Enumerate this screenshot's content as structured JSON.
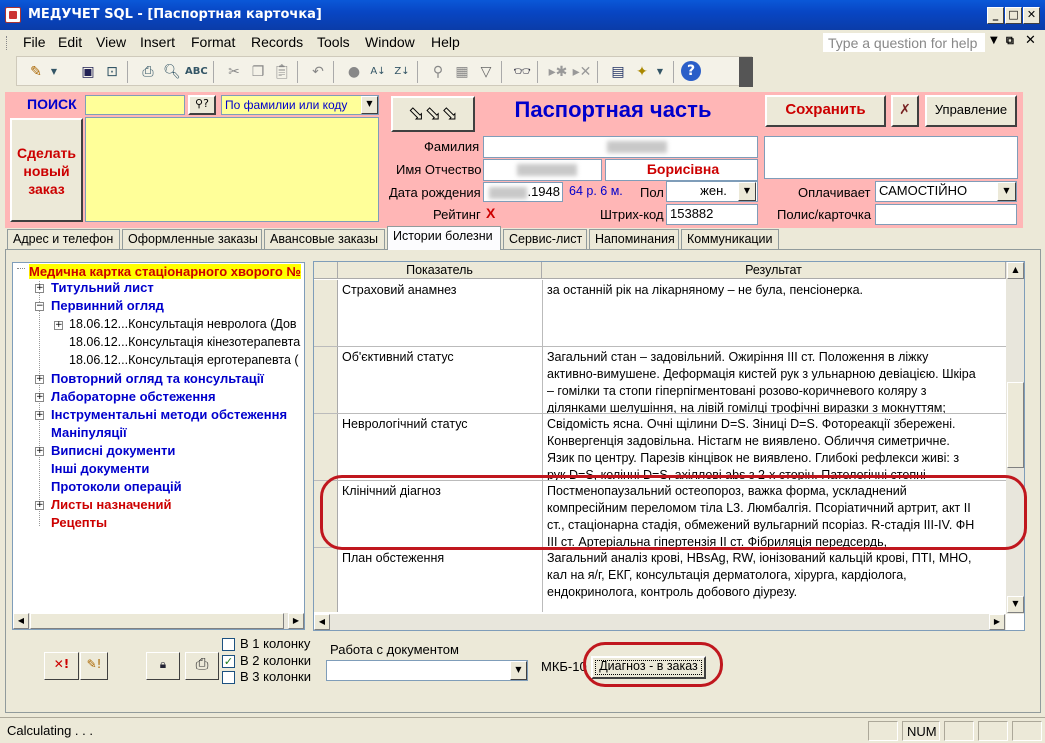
{
  "window": {
    "title": "МЕДУЧЕТ SQL - [Паспортная карточка]"
  },
  "menu": {
    "items": [
      "File",
      "Edit",
      "View",
      "Insert",
      "Format",
      "Records",
      "Tools",
      "Window",
      "Help"
    ],
    "help_placeholder": "Type a question for help"
  },
  "header": {
    "search_label": "ПОИСК",
    "search_value": "",
    "search_mode": "По фамилии или коду",
    "new_order_button": "Сделать новый заказ",
    "section_title": "Паспортная часть",
    "save_button": "Сохранить",
    "manage_button": "Управление",
    "surname_label": "Фамилия",
    "name_label": "Имя Отчество",
    "patronymic": "Борисівна",
    "dob_label": "Дата рождения",
    "dob_year": ".1948",
    "age": "64 р. 6 м.",
    "sex_label": "Пол",
    "sex_value": "жен.",
    "payer_label": "Оплачивает",
    "payer_value": "САМОСТІЙНО",
    "rating_label": "Рейтинг",
    "rating_value": "X",
    "barcode_label": "Штрих-код",
    "barcode_value": "153882",
    "policy_label": "Полис/карточка"
  },
  "tabs": [
    "Адрес и телефон",
    "Оформленные заказы",
    "Авансовые заказы",
    "Истории болезни",
    "Сервис-лист",
    "Напоминания",
    "Коммуникации"
  ],
  "active_tab": "Истории болезни",
  "tree": {
    "root": "Медична картка стаціонарного хворого №",
    "nodes": [
      {
        "label": "Титульний лист"
      },
      {
        "label": "Первинний огляд"
      },
      {
        "label": "18.06.12...Консультація невролога (Дов"
      },
      {
        "label": "18.06.12...Консультація кінезотерапевта"
      },
      {
        "label": "18.06.12...Консультація ерготерапевта ("
      },
      {
        "label": "Повторний огляд та консультації"
      },
      {
        "label": "Лабораторне обстеження"
      },
      {
        "label": "Інструментальні методи обстеження"
      },
      {
        "label": "Маніпуляції"
      },
      {
        "label": "Виписні документи"
      },
      {
        "label": "Інші документи"
      },
      {
        "label": "Протоколи операцій"
      },
      {
        "label": "Листы назначений"
      },
      {
        "label": "Рецепты"
      }
    ]
  },
  "grid": {
    "columns": [
      "Показатель",
      "Результат"
    ],
    "rows": [
      {
        "indicator": "Страховий анамнез",
        "result": "за останній рік на лікарняному – не була, пенсіонерка."
      },
      {
        "indicator": "Об'єктивний статус",
        "result": "Загальний стан – задовільний. Ожиріння ІІІ ст. Положення в ліжку активно-вимушене. Деформація кистей рук з ульнарною девіацією. Шкіра – гомілки та стопи гіперпігментовані розово-коричневого коляру з ділянками шелушіння, на лівій гомілці трофічні виразки з мокнуттям;"
      },
      {
        "indicator": "Неврологічний статус",
        "result": "Свідомість ясна. Очні щілини D=S. Зіниці D=S. Фотореакції збережені. Конвергенція задовільна. Ністагм не виявлено. Обличчя симетричне. Язик по центру. Парезів кінцівок не виявлено. Глибокі рефлекси живі: з рук D=S, колінні D=S, ахіллові abs з 2-х сторін. Патологічні стопні"
      },
      {
        "indicator": "Клінічний діагноз",
        "result": "Постменопаузальний остеопороз, важка форма, ускладнений компресійним переломом тіла L3. Люмбалгія. Псоріатичний артрит, акт ІІ ст., стаціонарна стадія, обмежений вульгарний псоріаз. R-стадія ІІІ-IV. ФН ІІІ ст. Артеріальна гіпертензія ІІ ст. Фібриляція передсердь,"
      },
      {
        "indicator": "План обстеження",
        "result": "Загальний аналіз крові, HBsAg, RW, іонізований кальцій крові, ПТІ, МНО, кал на я/г, ЕКГ, консультація дерматолога, хірурга, кардіолога, ендокринолога, контроль добового діурезу."
      }
    ]
  },
  "bottom": {
    "column_options": [
      "В 1 колонку",
      "В 2 колонки",
      "В 3 колонки"
    ],
    "checked_option": "В 2 колонки",
    "document_label": "Работа с документом",
    "document_value": "",
    "mkb_label": "МКБ-10",
    "diag_button": "Диагноз - в заказ"
  },
  "status": {
    "left": "Calculating . . .",
    "num": "NUM"
  }
}
